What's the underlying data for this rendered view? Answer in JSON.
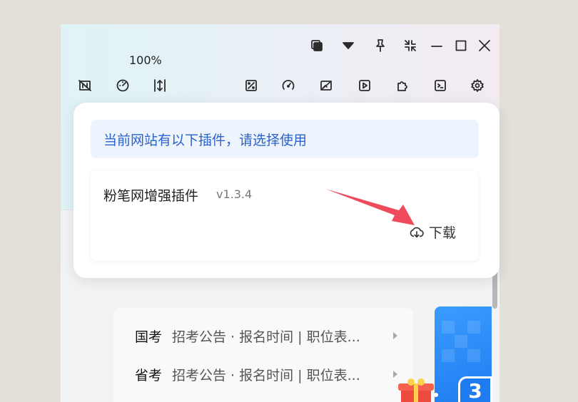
{
  "toolbar": {
    "zoom": "100%"
  },
  "popup": {
    "notice": "当前网站有以下插件，请选择使用",
    "plugin": {
      "name": "粉笔网增强插件",
      "version": "v1.3.4",
      "download_label": "下载"
    }
  },
  "list": [
    {
      "category": "国考",
      "desc": "招考公告 · 报名时间 | 职位表..."
    },
    {
      "category": "省考",
      "desc": "招考公告 · 报名时间 | 职位表..."
    }
  ],
  "promo": {
    "number": "3"
  },
  "colors": {
    "accent": "#2b62cc",
    "arrow": "#f04a5d",
    "promo": "#1f7cf0"
  }
}
